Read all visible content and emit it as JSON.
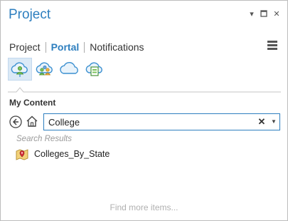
{
  "pane": {
    "title": "Project",
    "controls": {
      "pin": "▾",
      "maximize": "□",
      "close": "✕"
    }
  },
  "tabs": [
    {
      "label": "Project",
      "active": false
    },
    {
      "label": "Portal",
      "active": true
    },
    {
      "label": "Notifications",
      "active": false
    }
  ],
  "portal_views": [
    {
      "name": "my-content-icon",
      "selected": true
    },
    {
      "name": "groups-icon",
      "selected": false
    },
    {
      "name": "all-portal-icon",
      "selected": false
    },
    {
      "name": "living-atlas-icon",
      "selected": false
    }
  ],
  "section": {
    "title": "My Content"
  },
  "search": {
    "value": "College",
    "clear_glyph": "✕",
    "dropdown_glyph": "▼"
  },
  "results": {
    "header": "Search Results",
    "items": [
      {
        "label": "Colleges_By_State",
        "icon": "map-package-icon"
      }
    ]
  },
  "footer": {
    "find_more": "Find more items..."
  },
  "colors": {
    "accent": "#2e7fbf",
    "selected_bg": "#dbe9f6",
    "muted": "#9a9a9a"
  }
}
